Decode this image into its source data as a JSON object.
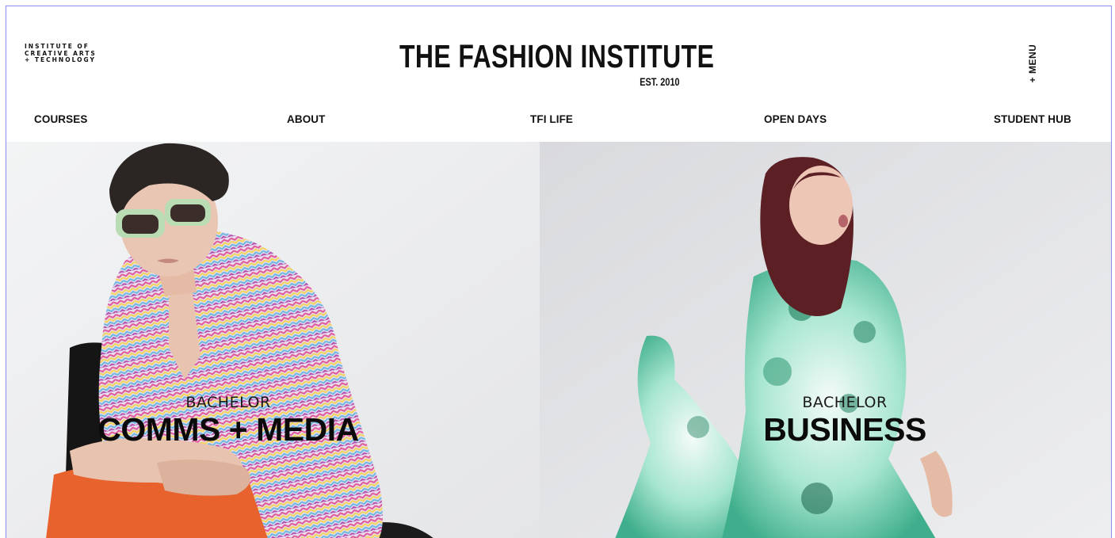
{
  "header": {
    "institute_tag": [
      "INSTITUTE OF",
      "CREATIVE ARTS",
      "+ TECHNOLOGY"
    ],
    "brand_title": "THE FASHION INSTITUTE",
    "brand_est": "EST. 2010",
    "menu_label": "+ MENU"
  },
  "nav": {
    "items": [
      {
        "label": "COURSES"
      },
      {
        "label": "ABOUT"
      },
      {
        "label": "TFI LIFE"
      },
      {
        "label": "OPEN DAYS"
      },
      {
        "label": "STUDENT HUB"
      }
    ]
  },
  "hero": {
    "panels": [
      {
        "subtitle": "BACHELOR",
        "title": "COMMS + MEDIA"
      },
      {
        "subtitle": "BACHELOR",
        "title": "BUSINESS"
      }
    ]
  },
  "colors": {
    "accent_border": "#8a8cf0",
    "text": "#111111",
    "shirt_pattern": [
      "#e05a9a",
      "#f2d35a",
      "#6fb7e0",
      "#e8e8e8"
    ],
    "pants": "#e8622e",
    "dress": "#7fd6b8"
  }
}
